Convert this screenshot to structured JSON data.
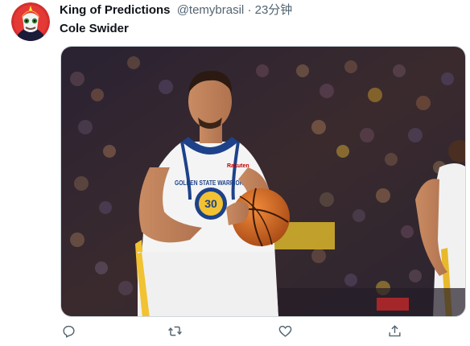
{
  "tweet": {
    "author_name": "King of Predictions",
    "author_handle": "@temybrasil",
    "separator": "·",
    "timestamp": "23分钟",
    "text": "Cole Swider"
  },
  "media": {
    "jersey_team": "GOLDEN STATE WARRIORS",
    "jersey_number": "30",
    "jersey_sponsor": "Rakuten"
  },
  "actions": {
    "reply_icon": "reply-icon",
    "retweet_icon": "retweet-icon",
    "like_icon": "heart-icon",
    "share_icon": "share-icon"
  },
  "colors": {
    "text_primary": "#0f1419",
    "text_secondary": "#536471",
    "border": "#cfd9de"
  }
}
